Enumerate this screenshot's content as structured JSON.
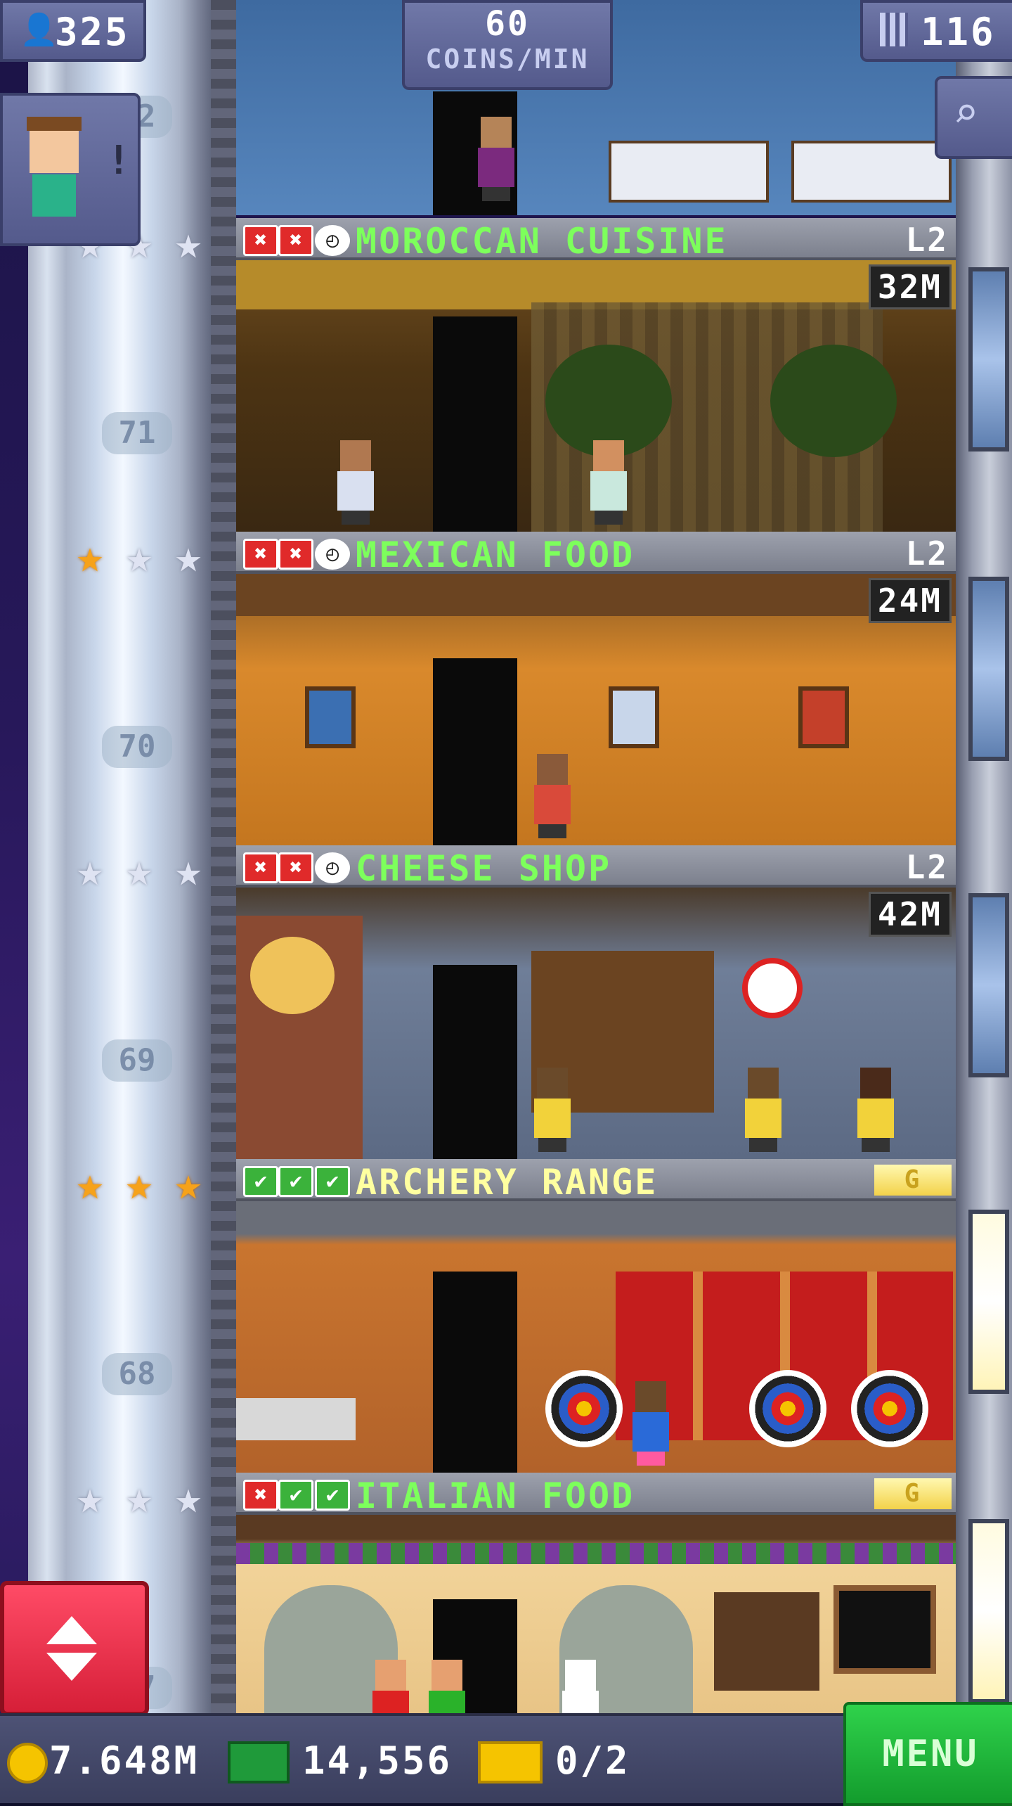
{
  "hud": {
    "population": "325",
    "coins_rate_value": "60",
    "coins_rate_unit": "COINS/MIN",
    "floors_count": "116"
  },
  "shaft_floor_numbers": [
    "72",
    "71",
    "70",
    "69",
    "68",
    "67"
  ],
  "floors": [
    {
      "name": "MOROCCAN CUISINE",
      "level": "L2",
      "timer": "32M",
      "status": [
        "x",
        "x",
        "clock"
      ],
      "stars": [
        "silver",
        "silver",
        "silver"
      ]
    },
    {
      "name": "MEXICAN FOOD",
      "level": "L2",
      "timer": "24M",
      "status": [
        "x",
        "x",
        "clock"
      ],
      "stars": [
        "gold",
        "silver",
        "silver"
      ]
    },
    {
      "name": "CHEESE SHOP",
      "level": "L2",
      "timer": "42M",
      "status": [
        "x",
        "x",
        "clock"
      ],
      "stars": [
        "silver",
        "silver",
        "silver"
      ]
    },
    {
      "name": "ARCHERY RANGE",
      "badge": "G",
      "status": [
        "check",
        "check",
        "check"
      ],
      "stars": [
        "gold",
        "gold",
        "gold"
      ]
    },
    {
      "name": "ITALIAN FOOD",
      "badge": "G",
      "status": [
        "x",
        "check",
        "check"
      ],
      "stars": [
        "silver",
        "silver",
        "silver"
      ]
    }
  ],
  "bottom": {
    "coins": "7.648M",
    "bux": "14,556",
    "tickets": "0/2",
    "menu_label": "MENU"
  },
  "colors": {
    "floor_name_green": "#7dff5c",
    "floor_name_gold": "#ffffa0",
    "menu_green": "#139c2d",
    "elevator_red": "#d61f38"
  }
}
